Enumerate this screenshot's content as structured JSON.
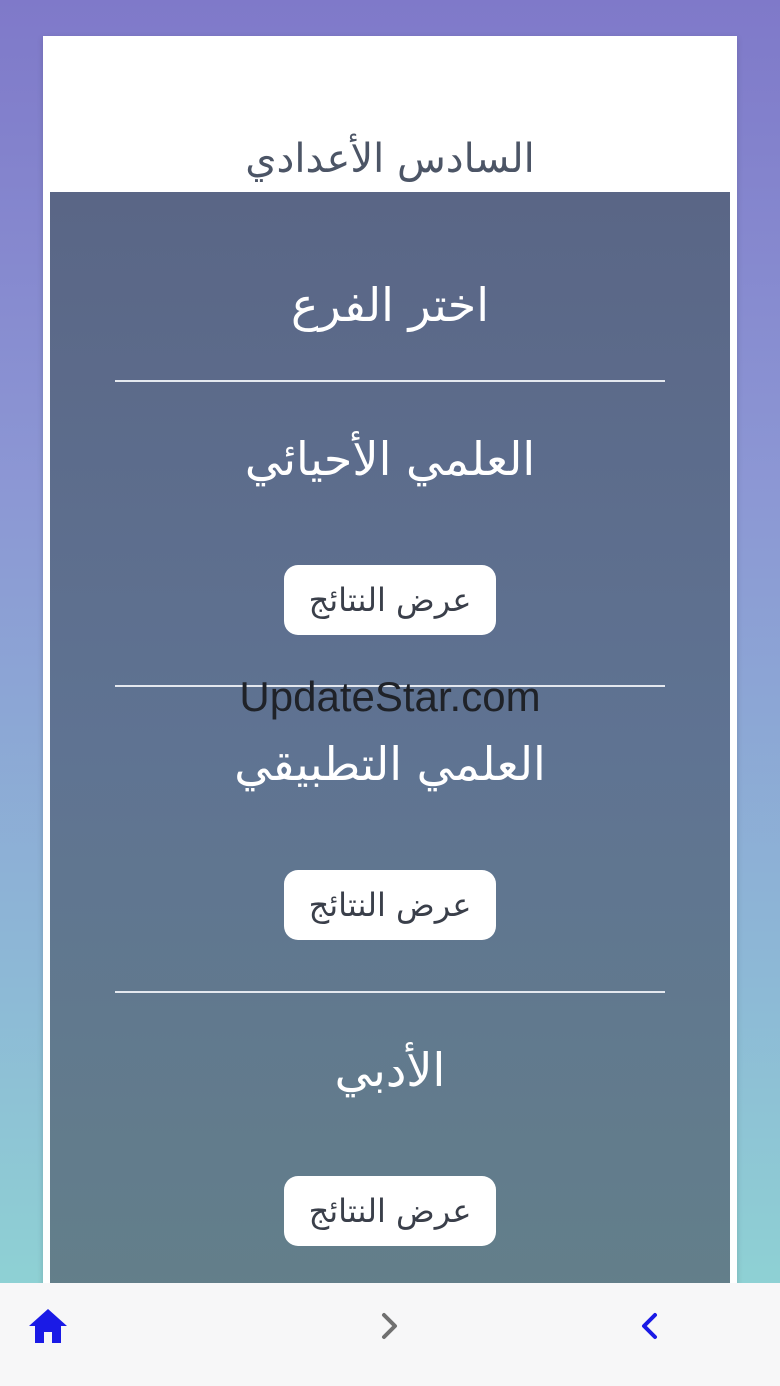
{
  "header": {
    "title": "السادس الأعدادي"
  },
  "panel": {
    "choose_label": "اختر الفرع",
    "sections": [
      {
        "name": "العلمي الأحيائي",
        "button_label": "عرض النتائج"
      },
      {
        "name": "العلمي التطبيقي",
        "button_label": "عرض النتائج"
      },
      {
        "name": "الأدبي",
        "button_label": "عرض النتائج"
      }
    ]
  },
  "watermark": "UpdateStar.com",
  "bottom_nav": {
    "icons": [
      "home-icon",
      "chevron-right-icon",
      "chevron-left-icon"
    ],
    "colors": {
      "home": "#1a1ae6",
      "forward": "#707070",
      "back": "#1a1ae6"
    }
  }
}
